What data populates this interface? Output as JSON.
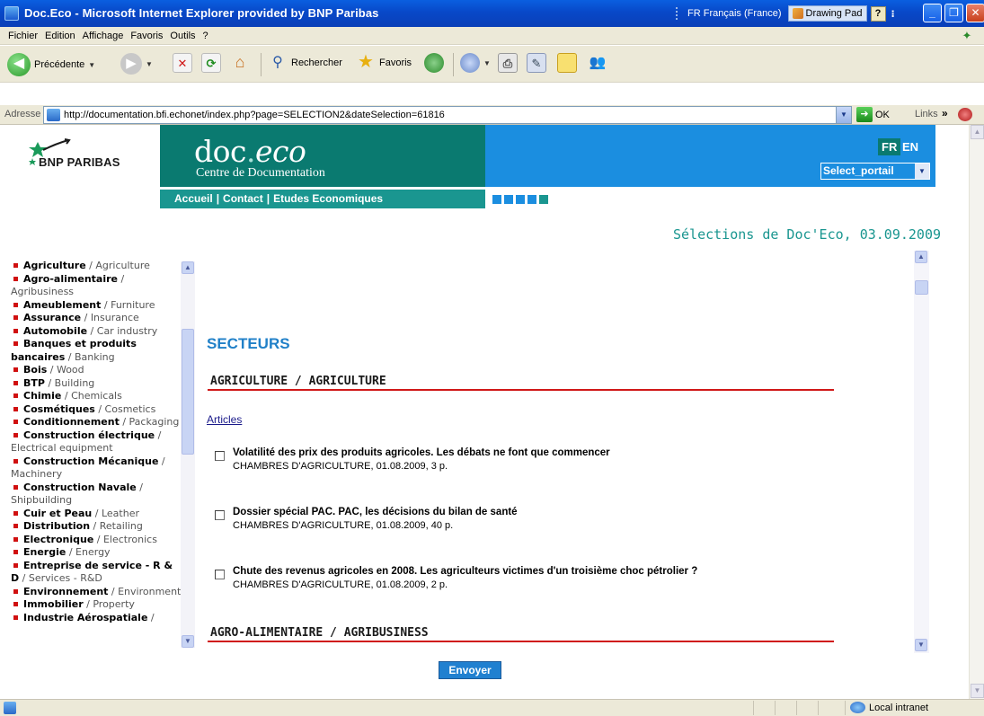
{
  "window": {
    "title": "Doc.Eco - Microsoft Internet Explorer provided by BNP Paribas",
    "language": "FR Français (France)",
    "drawing_pad": "Drawing Pad",
    "help_label": "?"
  },
  "menu": [
    "Fichier",
    "Edition",
    "Affichage",
    "Favoris",
    "Outils",
    "?"
  ],
  "toolbar": {
    "back": "Précédente",
    "search": "Rechercher",
    "favorites": "Favoris"
  },
  "address": {
    "label": "Adresse",
    "url": "http://documentation.bfi.echonet/index.php?page=SELECTION2&dateSelection=61816",
    "go": "OK",
    "links": "Links"
  },
  "header": {
    "brand": "BNP PARIBAS",
    "doc_title_main": "doc",
    "doc_title_dot": ".",
    "doc_title_eco": "eco",
    "subtitle": "Centre de Documentation",
    "lang_fr": "FR",
    "lang_en": "EN",
    "portal_value": "Select_portail",
    "nav": [
      "Accueil",
      "Contact",
      "Etudes Economiques"
    ],
    "nav_sep": "|",
    "square_colors": [
      "#1b8ee0",
      "#1b8ee0",
      "#1b8ee0",
      "#1b8ee0",
      "#1a9690"
    ]
  },
  "selection_title": "Sélections de Doc'Eco, 03.09.2009",
  "categories": [
    {
      "fr": "Agriculture",
      "en": "Agriculture"
    },
    {
      "fr": "Agro-alimentaire",
      "en": "Agribusiness"
    },
    {
      "fr": "Ameublement",
      "en": "Furniture"
    },
    {
      "fr": "Assurance",
      "en": "Insurance"
    },
    {
      "fr": "Automobile",
      "en": "Car industry"
    },
    {
      "fr": "Banques et produits bancaires",
      "en": "Banking"
    },
    {
      "fr": "Bois",
      "en": "Wood"
    },
    {
      "fr": "BTP",
      "en": "Building"
    },
    {
      "fr": "Chimie",
      "en": "Chemicals"
    },
    {
      "fr": "Cosmétiques",
      "en": "Cosmetics"
    },
    {
      "fr": "Conditionnement",
      "en": "Packaging"
    },
    {
      "fr": "Construction électrique",
      "en": "Electrical equipment"
    },
    {
      "fr": "Construction Mécanique",
      "en": "Machinery"
    },
    {
      "fr": "Construction Navale",
      "en": "Shipbuilding"
    },
    {
      "fr": "Cuir et Peau",
      "en": "Leather"
    },
    {
      "fr": "Distribution",
      "en": "Retailing"
    },
    {
      "fr": "Electronique",
      "en": "Electronics"
    },
    {
      "fr": "Energie",
      "en": "Energy"
    },
    {
      "fr": "Entreprise de service - R & D",
      "en": "Services - R&D"
    },
    {
      "fr": "Environnement",
      "en": "Environment"
    },
    {
      "fr": "Immobilier",
      "en": "Property"
    },
    {
      "fr": "Industrie Aérospatiale",
      "en": ""
    }
  ],
  "main": {
    "heading": "SECTEURS",
    "sector1": "AGRICULTURE / AGRICULTURE",
    "articles_link": "Articles",
    "articles": [
      {
        "title": "Volatilité des prix des produits agricoles. Les débats ne font que commencer",
        "source": "CHAMBRES D'AGRICULTURE, 01.08.2009, 3 p."
      },
      {
        "title": "Dossier spécial PAC. PAC, les décisions du bilan de santé",
        "source": "CHAMBRES D'AGRICULTURE, 01.08.2009, 40 p."
      },
      {
        "title": "Chute des revenus agricoles en 2008. Les agriculteurs victimes d'un troisième choc pétrolier ?",
        "source": "CHAMBRES D'AGRICULTURE, 01.08.2009, 2 p."
      }
    ],
    "sector2": "AGRO-ALIMENTAIRE / AGRIBUSINESS",
    "submit": "Envoyer"
  },
  "status": {
    "zone": "Local intranet"
  }
}
